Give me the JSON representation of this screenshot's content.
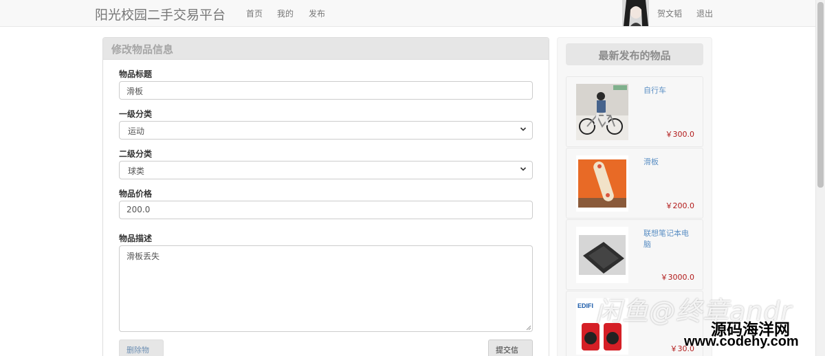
{
  "nav": {
    "brand": "阳光校园二手交易平台",
    "links": [
      "首页",
      "我的",
      "发布"
    ],
    "user": "贺文韬",
    "logout": "退出"
  },
  "form": {
    "heading": "修改物品信息",
    "title_label": "物品标题",
    "title_value": "滑板",
    "cat1_label": "一级分类",
    "cat1_value": "运动",
    "cat2_label": "二级分类",
    "cat2_value": "球类",
    "price_label": "物品价格",
    "price_value": "200.0",
    "desc_label": "物品描述",
    "desc_value": "滑板丢失",
    "delete_label": "删除物品",
    "submit_label": "提交信息"
  },
  "sidebar": {
    "title": "最新发布的物品",
    "items": [
      {
        "name": "自行车",
        "price": "￥300.0"
      },
      {
        "name": "滑板",
        "price": "￥200.0"
      },
      {
        "name": "联想笔记本电脑",
        "price": "￥3000.0"
      },
      {
        "name": "",
        "price": "￥30.0"
      }
    ]
  },
  "watermark": {
    "line": "闲鱼@终章andr",
    "site": "源码海洋网",
    "url": "www.codehy.com"
  },
  "colors": {
    "navbar_bg": "#f8f8f8",
    "panel_heading_bg": "#e6e6e6",
    "link_blue": "#5b8fc4",
    "price_red": "#b11818"
  }
}
